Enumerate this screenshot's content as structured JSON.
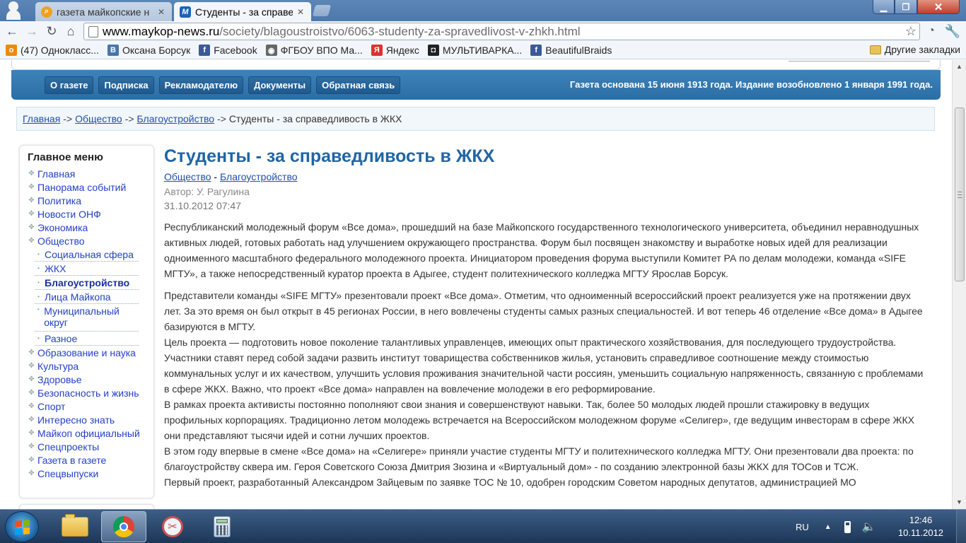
{
  "browser": {
    "tabs": [
      {
        "title": "газета майкопские н",
        "active": false
      },
      {
        "title": "Студенты - за справе",
        "active": true
      }
    ],
    "url_host": "www.maykop-news.ru",
    "url_path": "/society/blagoustroistvo/6063-studenty-za-spravedlivost-v-zhkh.html",
    "bookmarks": [
      {
        "label": "(47) Однокласс...",
        "icon": "odnoklassniki-icon",
        "color": "#f08a00",
        "glyph": "о"
      },
      {
        "label": "Оксана Борсук",
        "icon": "vk-icon",
        "color": "#4a76a8",
        "glyph": "B"
      },
      {
        "label": "Facebook",
        "icon": "facebook-icon",
        "color": "#3b5998",
        "glyph": "f"
      },
      {
        "label": "ФГБОУ ВПО Ма...",
        "icon": "globe-icon",
        "color": "#666666",
        "glyph": "◉"
      },
      {
        "label": "Яндекс",
        "icon": "yandex-icon",
        "color": "#e03030",
        "glyph": "Я"
      },
      {
        "label": "МУЛЬТИВАРКА...",
        "icon": "camera-icon",
        "color": "#222222",
        "glyph": "◘"
      },
      {
        "label": "BeautifulBraids",
        "icon": "facebook-icon",
        "color": "#3b5998",
        "glyph": "f"
      }
    ],
    "other_bookmarks": "Другие закладки"
  },
  "site": {
    "nav": [
      "О газете",
      "Подписка",
      "Рекламодателю",
      "Документы",
      "Обратная связь"
    ],
    "tagline": "Газета основана 15 июня 1913 года. Издание возобновлено 1 января 1991 года.",
    "breadcrumb": {
      "home": "Главная",
      "section": "Общество",
      "subsection": "Благоустройство",
      "current": "Студенты - за справедливость в ЖКХ",
      "sep": "->"
    },
    "sidebar": {
      "title": "Главное меню",
      "items": [
        {
          "label": "Главная",
          "level": 1
        },
        {
          "label": "Панорама событий",
          "level": 1
        },
        {
          "label": "Политика",
          "level": 1
        },
        {
          "label": "Новости ОНФ",
          "level": 1
        },
        {
          "label": "Экономика",
          "level": 1
        },
        {
          "label": "Общество",
          "level": 1
        },
        {
          "label": "Социальная сфера",
          "level": 2
        },
        {
          "label": "ЖКХ",
          "level": 2
        },
        {
          "label": "Благоустройство",
          "level": 2,
          "active": true
        },
        {
          "label": "Лица Майкопа",
          "level": 2
        },
        {
          "label": "Муниципальный округ",
          "level": 2,
          "tall": true
        },
        {
          "label": "Разное",
          "level": 2
        },
        {
          "label": "Образование и наука",
          "level": 1
        },
        {
          "label": "Культура",
          "level": 1
        },
        {
          "label": "Здоровье",
          "level": 1
        },
        {
          "label": "Безопасность и жизнь",
          "level": 1
        },
        {
          "label": "Спорт",
          "level": 1
        },
        {
          "label": "Интересно знать",
          "level": 1
        },
        {
          "label": "Майкоп официальный",
          "level": 1
        },
        {
          "label": "Спецпроекты",
          "level": 1
        },
        {
          "label": "Газета в газете",
          "level": 1
        },
        {
          "label": "Спецвыпуски",
          "level": 1
        }
      ]
    },
    "article": {
      "title": "Студенты - за справедливость в ЖКХ",
      "category_1": "Общество",
      "category_sep": " - ",
      "category_2": "Благоустройство",
      "author": "Автор: У. Рагулина",
      "date": "31.10.2012 07:47",
      "paragraphs": [
        "Республиканский молодежный форум «Все дома», прошедший на базе Майкопского государственного технологического университета, объединил неравнодушных активных людей, готовых работать над улучшением окружающего пространства. Форум был посвящен знакомству и выработке новых идей для реализации одноименного масштабного федерального молодежного проекта. Инициатором проведения форума выступили Комитет РА по делам молодежи, команда «SIFE МГТУ», а также непосредственный куратор проекта в Адыгее, студент политехнического колледжа МГТУ Ярослав Борсук.",
        "Представители команды «SIFE МГТУ» презентовали проект «Все дома». Отметим, что одноименный всероссийский проект реализуется уже на протяжении двух лет. За это время он был открыт в 45 регионах России, в него вовлечены студенты самых разных специальностей. И вот теперь 46 отделение «Все дома» в Адыгее базируются в МГТУ.",
        "Цель проекта — подготовить новое поколение талантливых управленцев, имеющих опыт практического хозяйствования, для последующего трудоустройства. Участники ставят перед собой задачи развить институт товарищества собственников жилья, установить справедливое соотношение между стоимостью коммунальных услуг и их качеством, улучшить условия проживания значительной части россиян, уменьшить социальную напряженность, связанную с проблемами в сфере ЖКХ. Важно, что проект «Все дома» направлен на вовлечение молодежи в его реформирование.",
        "В рамках проекта активисты постоянно пополняют свои знания и совершенствуют навыки. Так, более 50 молодых людей прошли стажировку в ведущих профильных корпорациях. Традиционно летом молодежь встречается на Всероссийском молодежном форуме «Селигер», где ведущим инвесторам в сфере ЖКХ они представляют тысячи идей и сотни лучших проектов.",
        "В этом году впервые в смене «Все дома» на «Селигере» приняли участие студенты МГТУ и политехнического колледжа МГТУ. Они презентовали два проекта: по благоустройству сквера им. Героя Советского Союза Дмитрия Зюзина и «Виртуальный дом» - по созданию электронной базы ЖКХ для ТОСов и ТСЖ.",
        "Первый проект, разработанный Александром Зайцевым по заявке ТОС № 10, одобрен городским Советом народных депутатов, администрацией МО"
      ]
    }
  },
  "taskbar": {
    "language": "RU",
    "time": "12:46",
    "date": "10.11.2012",
    "apps": [
      {
        "name": "explorer-icon"
      },
      {
        "name": "chrome-icon",
        "active": true
      },
      {
        "name": "snipping-tool-icon"
      },
      {
        "name": "calculator-icon"
      }
    ]
  }
}
